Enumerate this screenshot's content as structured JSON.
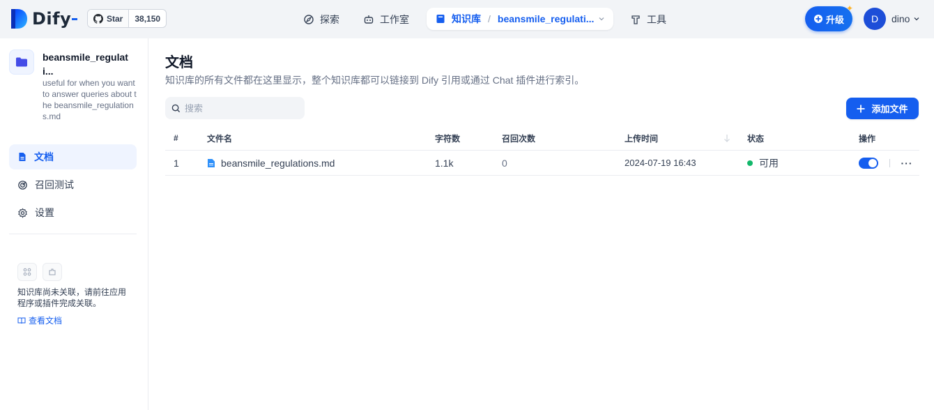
{
  "header": {
    "logo_text": "Dify",
    "github": {
      "star_label": "Star",
      "star_count": "38,150",
      "icon": "github-icon"
    },
    "nav": {
      "explore": "探索",
      "studio": "工作室",
      "knowledge": "知识库",
      "knowledge_current": "beansmile_regulati...",
      "tools": "工具"
    },
    "upgrade_label": "升级",
    "user": {
      "avatar_letter": "D",
      "name": "dino"
    }
  },
  "sidebar": {
    "dataset_name": "beansmile_regulati...",
    "dataset_description": "useful for when you want to answer queries about the beansmile_regulations.md",
    "items": [
      {
        "label": "文档",
        "icon": "document-icon",
        "active": true
      },
      {
        "label": "召回测试",
        "icon": "target-icon",
        "active": false
      },
      {
        "label": "设置",
        "icon": "gear-icon",
        "active": false
      }
    ],
    "relation_text": "知识库尚未关联，请前往应用程序或插件完成关联。",
    "docs_link": "查看文档"
  },
  "main": {
    "title": "文档",
    "description": "知识库的所有文件都在这里显示，整个知识库都可以链接到 Dify 引用或通过 Chat 插件进行索引。",
    "search_placeholder": "搜索",
    "add_button": "添加文件",
    "table": {
      "headers": [
        "#",
        "文件名",
        "字符数",
        "召回次数",
        "上传时间",
        "状态",
        "操作"
      ],
      "rows": [
        {
          "index": "1",
          "name": "beansmile_regulations.md",
          "chars": "1.1k",
          "hits": "0",
          "upload_time": "2024-07-19 16:43",
          "status": "可用",
          "enabled": true
        }
      ]
    }
  },
  "colors": {
    "accent": "#155eef",
    "status_ok": "#12b76a",
    "topbar_bg": "#f2f4f7"
  }
}
